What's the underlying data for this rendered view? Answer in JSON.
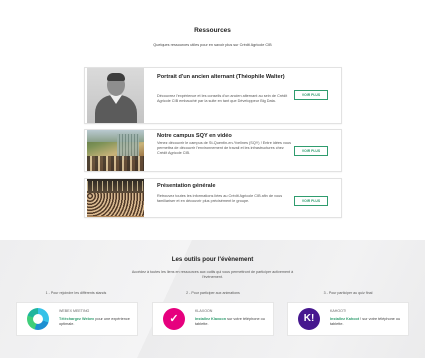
{
  "ressources": {
    "title": "Ressources",
    "subtitle": "Quelques ressources utiles pour en savoir plus sur Crédit Agricole CIB",
    "cards": [
      {
        "title": "Portrait d'un ancien alternant (Théophile Walter)",
        "description": "Découvrez l'expérience et les conseils d'un ancien alternant au sein de Crédit Agricole CIB embauché par la suite en tant que Développeur Big Data.",
        "button": "VOIR PLUS"
      },
      {
        "title": "Notre campus SQY en vidéo",
        "description": "Venez découvrir le campus de St-Quentin-en-Yvelines (SQY) ! Entre idées vous permettra de découvrir l'environnement de travail et les infrastructures chez Crédit Agricole CIB.",
        "button": "VOIR PLUS"
      },
      {
        "title": "Présentation générale",
        "description": "Retrouvez toutes les informations liées au Crédit Agricole CIB afin de vous familiariser et en découvrir plus précisément le groupe.",
        "button": "VOIR PLUS"
      }
    ]
  },
  "outils": {
    "title": "Les outils pour l'évènement",
    "intro": "Accédez à toutes les liens en ressources aux outils qui vous permettront de participer activement à l'évènement.",
    "columns": [
      {
        "step": "1 - Pour rejoindre les différents stands",
        "app_name": "WEBEX MEETING",
        "link": "Téléchargez Webex",
        "text": " pour une expérience optimale.",
        "icon": "webex-icon"
      },
      {
        "step": "2 - Pour participer aux animations",
        "app_name": "KLAXOON",
        "link": "Installez Klaxoon",
        "text": " sur votre téléphone ou tablette.",
        "icon": "klaxoon-icon"
      },
      {
        "step": "3 - Pour participer au quiz final",
        "app_name": "KAHOOT!",
        "link": "Installez Kahoot",
        "text": " ! sur votre téléphone ou tablette.",
        "icon": "kahoot-icon"
      }
    ]
  },
  "colors": {
    "accent_green": "#2f9c6e",
    "klaxoon_pink": "#e6007e",
    "kahoot_purple": "#46178f"
  }
}
